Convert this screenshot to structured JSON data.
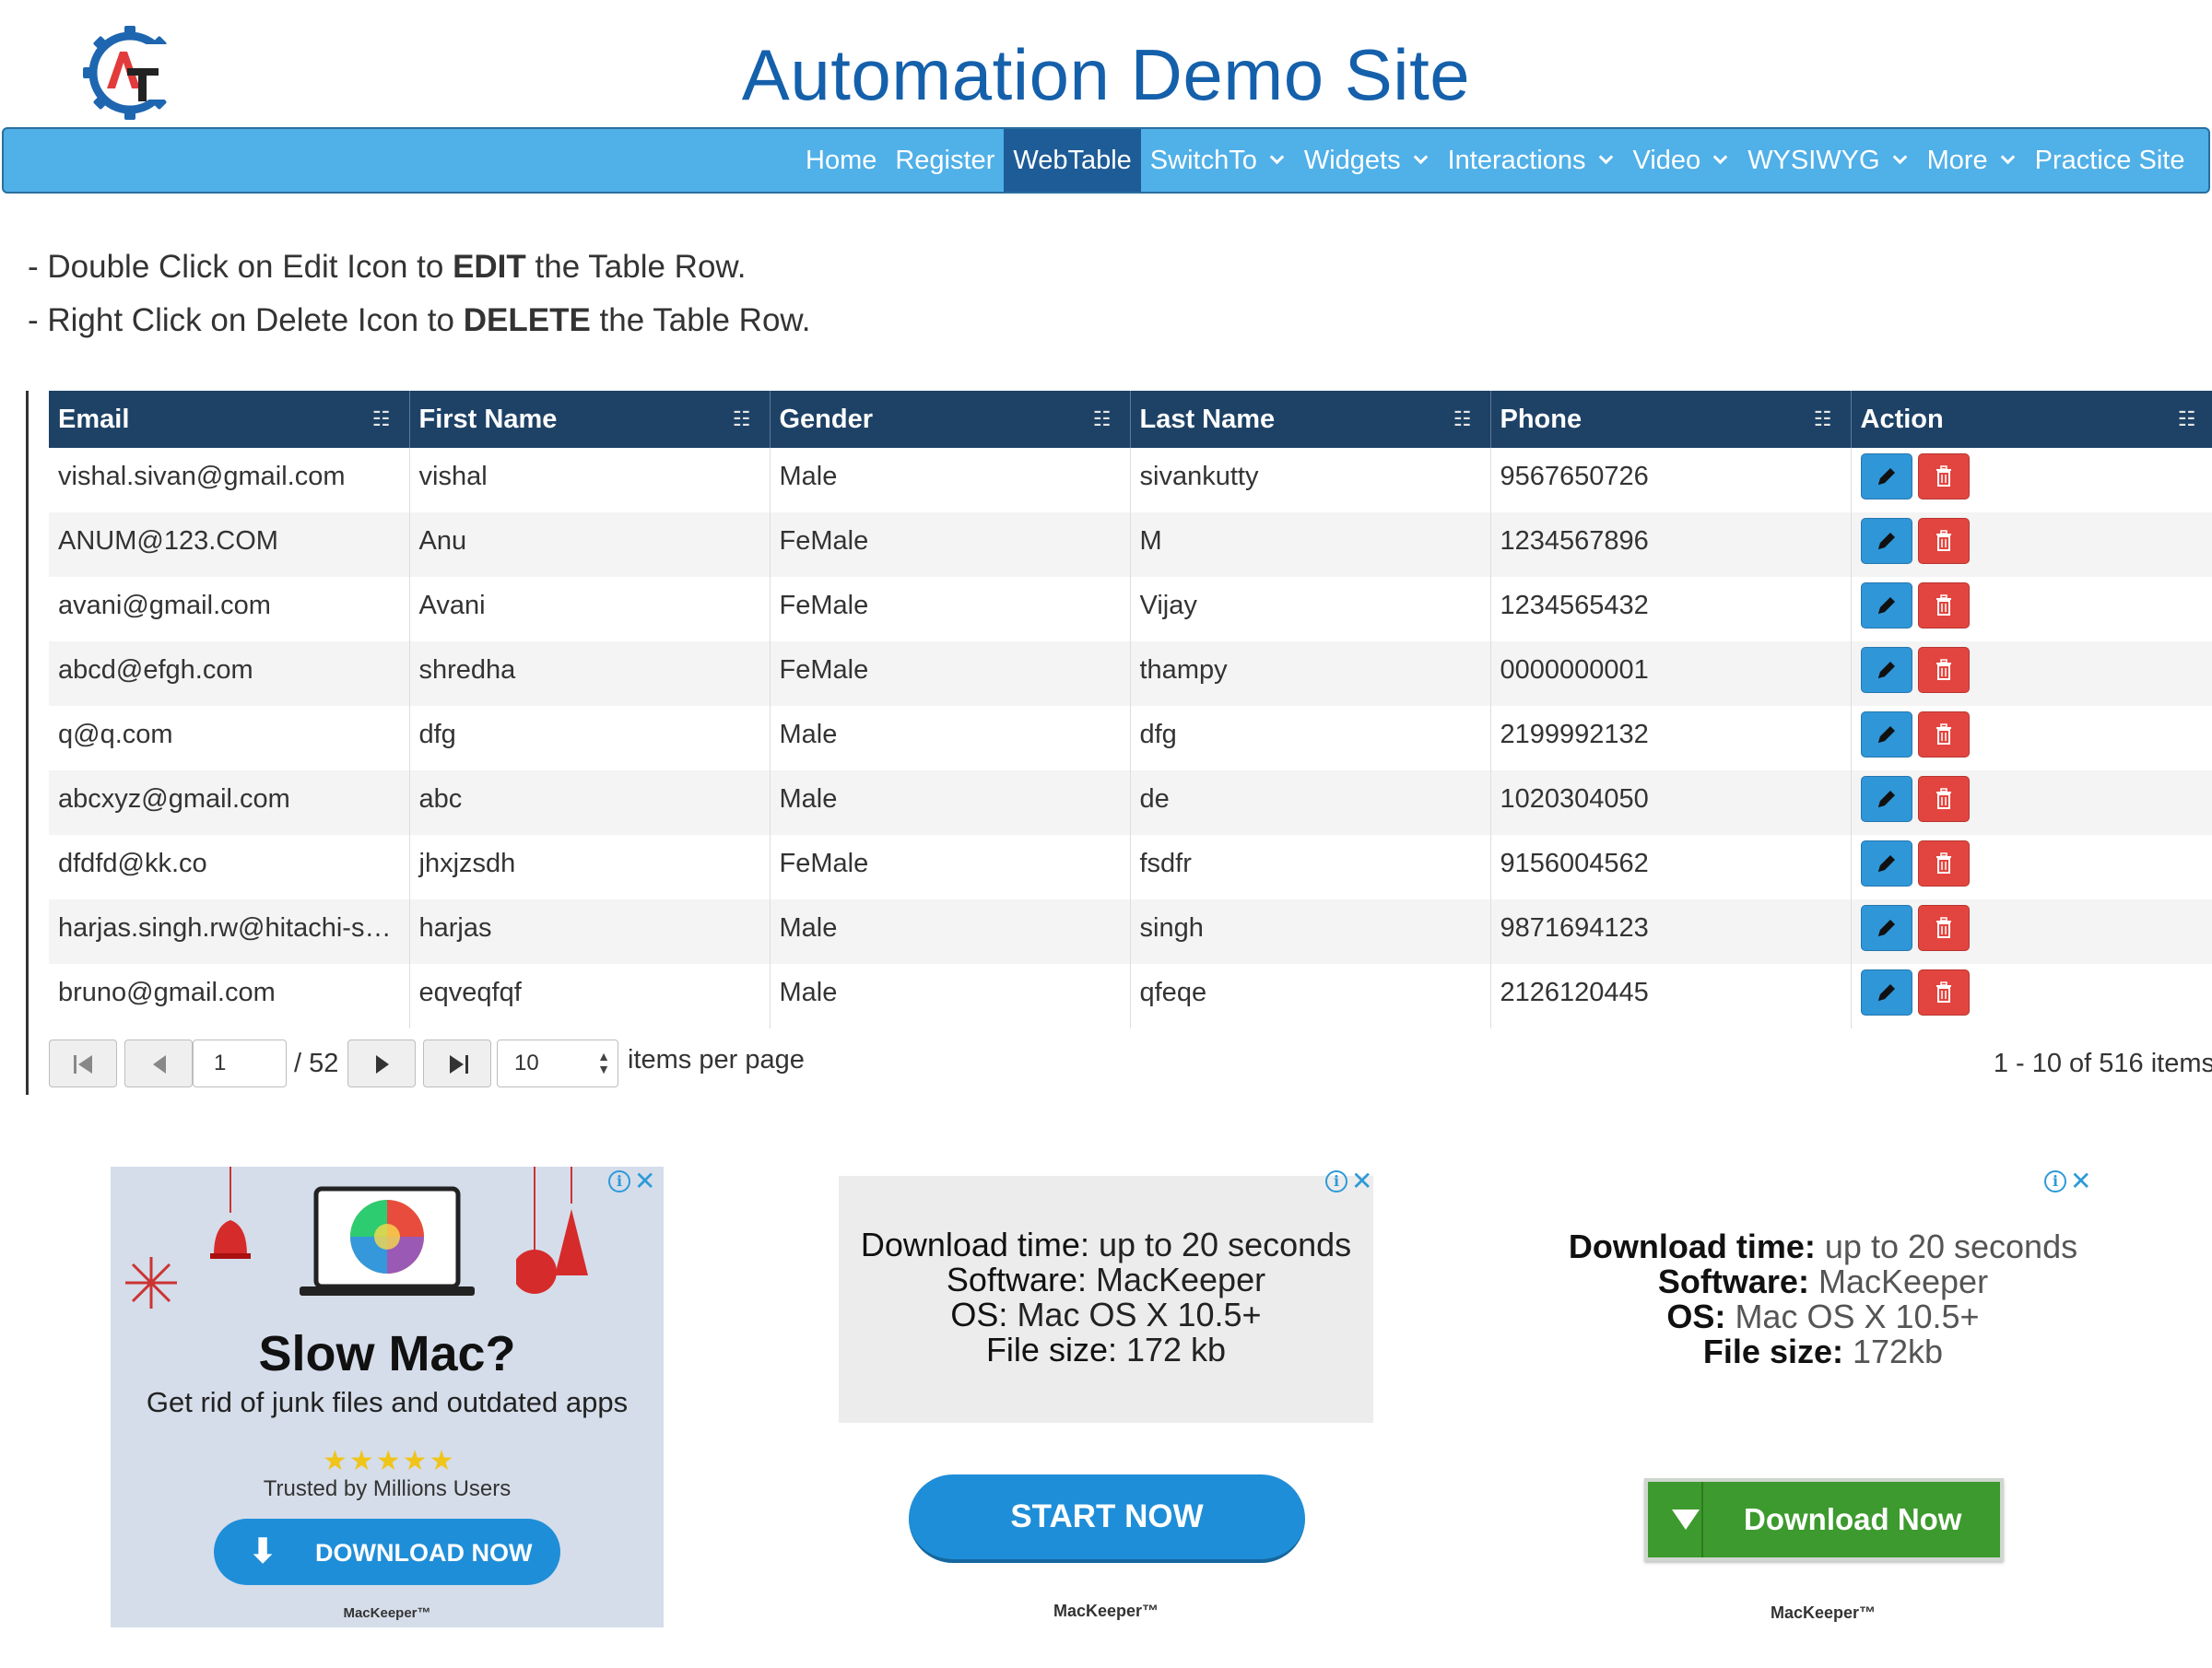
{
  "site": {
    "title": "Automation Demo Site",
    "logo_letters": "AT"
  },
  "nav": {
    "items": [
      {
        "label": "Home",
        "has_caret": false,
        "active": false
      },
      {
        "label": "Register",
        "has_caret": false,
        "active": false
      },
      {
        "label": "WebTable",
        "has_caret": false,
        "active": true
      },
      {
        "label": "SwitchTo",
        "has_caret": true,
        "active": false
      },
      {
        "label": "Widgets",
        "has_caret": true,
        "active": false
      },
      {
        "label": "Interactions",
        "has_caret": true,
        "active": false
      },
      {
        "label": "Video",
        "has_caret": true,
        "active": false
      },
      {
        "label": "WYSIWYG",
        "has_caret": true,
        "active": false
      },
      {
        "label": "More",
        "has_caret": true,
        "active": false
      },
      {
        "label": "Practice Site",
        "has_caret": false,
        "active": false
      }
    ]
  },
  "instructions": {
    "line1": {
      "prefix": "- Double Click on Edit Icon to ",
      "bold": "EDIT",
      "suffix": " the Table Row."
    },
    "line2": {
      "prefix": "- Right Click on Delete Icon to ",
      "bold": "DELETE",
      "suffix": " the Table Row."
    }
  },
  "table": {
    "columns": [
      "Email",
      "First Name",
      "Gender",
      "Last Name",
      "Phone",
      "Action"
    ],
    "column_icon": "grid-options-icon",
    "rows": [
      [
        "vishal.sivan@gmail.com",
        "vishal",
        "Male",
        "sivankutty",
        "9567650726"
      ],
      [
        "ANUM@123.COM",
        "Anu",
        "FeMale",
        "M",
        "1234567896"
      ],
      [
        "avani@gmail.com",
        "Avani",
        "FeMale",
        "Vijay",
        "1234565432"
      ],
      [
        "abcd@efgh.com",
        "shredha",
        "FeMale",
        "thampy",
        "0000000001"
      ],
      [
        "q@q.com",
        "dfg",
        "Male",
        "dfg",
        "2199992132"
      ],
      [
        "abcxyz@gmail.com",
        "abc",
        "Male",
        "de",
        "1020304050"
      ],
      [
        "dfdfd@kk.co",
        "jhxjzsdh",
        "FeMale",
        "fsdfr",
        "9156004562"
      ],
      [
        "harjas.singh.rw@hitachi-sy…",
        "harjas",
        "Male",
        "singh",
        "9871694123"
      ],
      [
        "bruno@gmail.com",
        "eqveqfqf",
        "Male",
        "qfeqe",
        "2126120445"
      ]
    ],
    "edit_icon": "pencil-icon",
    "delete_icon": "trash-icon",
    "colors": {
      "header_bg": "#1e4266",
      "edit_btn": "#2f96d8",
      "delete_btn": "#e2453f"
    }
  },
  "pager": {
    "current_page": "1",
    "total_pages": "/ 52",
    "page_size": "10",
    "items_per_page_label": "items per page",
    "summary": "1 - 10 of 516 items"
  },
  "ads": {
    "ad1": {
      "title": "Slow Mac?",
      "subtitle": "Get rid of junk files and outdated apps",
      "stars": "★★★★★",
      "trusted": "Trusted by Millions Users",
      "button": "DOWNLOAD NOW",
      "brand": "MacKeeper™"
    },
    "ad2": {
      "line1_key": "Download time:",
      "line1_val": " up to 20 seconds",
      "line2_key": "Software:",
      "line2_val": " MacKeeper",
      "line3_key": "OS:",
      "line3_val": " Mac OS X 10.5+",
      "line4_key": "File size:",
      "line4_val": " 172 kb",
      "button": "START NOW",
      "brand": "MacKeeper™"
    },
    "ad3": {
      "line1_key": "Download time:",
      "line1_val": " up to 20 seconds",
      "line2_key": "Software:",
      "line2_val": " MacKeeper",
      "line3_key": "OS:",
      "line3_val": " Mac OS X 10.5+",
      "line4_key": "File size:",
      "line4_val": " 172kb",
      "button": "Download Now",
      "brand": "MacKeeper™"
    },
    "info_icon": "ad-info-icon",
    "close_icon": "ad-close-icon"
  }
}
